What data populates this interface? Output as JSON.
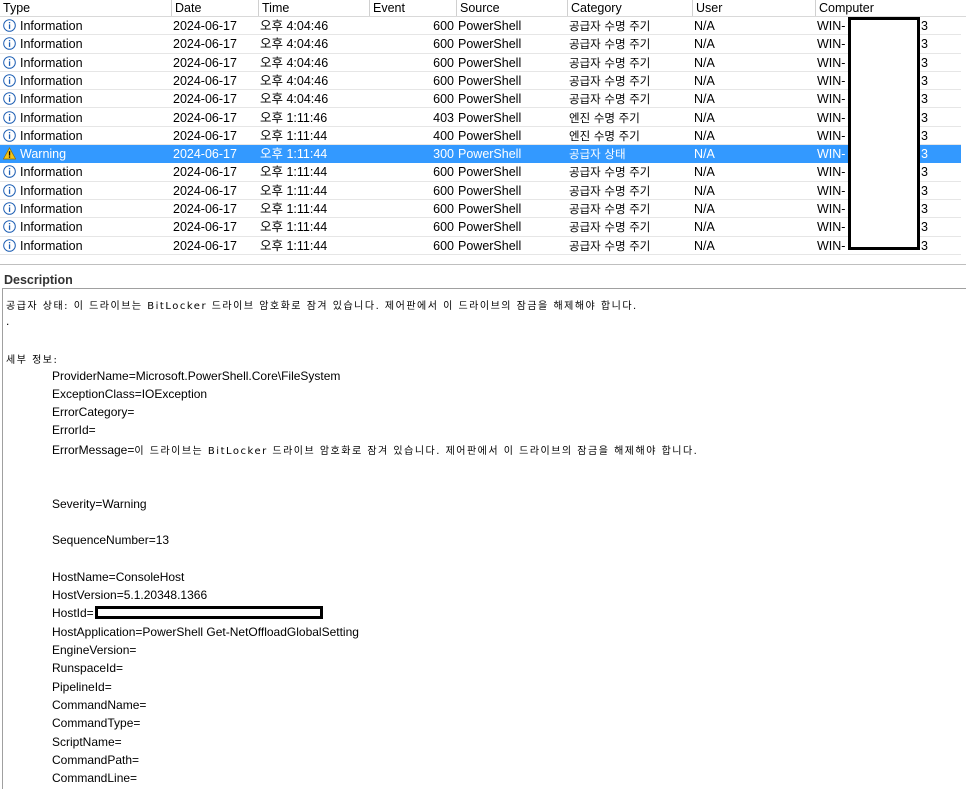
{
  "columns": [
    "Type",
    "Date",
    "Time",
    "Event",
    "Source",
    "Category",
    "User",
    "Computer"
  ],
  "rows": [
    {
      "type": "Information",
      "icon": "info-icon",
      "date": "2024-06-17",
      "time": "오후 4:04:46",
      "event": "600",
      "source": "PowerShell",
      "category": "공급자 수명 주기",
      "user": "N/A",
      "computer": "WIN-",
      "computer_tail": "3",
      "selected": false
    },
    {
      "type": "Information",
      "icon": "info-icon",
      "date": "2024-06-17",
      "time": "오후 4:04:46",
      "event": "600",
      "source": "PowerShell",
      "category": "공급자 수명 주기",
      "user": "N/A",
      "computer": "WIN-",
      "computer_tail": "3",
      "selected": false
    },
    {
      "type": "Information",
      "icon": "info-icon",
      "date": "2024-06-17",
      "time": "오후 4:04:46",
      "event": "600",
      "source": "PowerShell",
      "category": "공급자 수명 주기",
      "user": "N/A",
      "computer": "WIN-",
      "computer_tail": "3",
      "selected": false
    },
    {
      "type": "Information",
      "icon": "info-icon",
      "date": "2024-06-17",
      "time": "오후 4:04:46",
      "event": "600",
      "source": "PowerShell",
      "category": "공급자 수명 주기",
      "user": "N/A",
      "computer": "WIN-",
      "computer_tail": "3",
      "selected": false
    },
    {
      "type": "Information",
      "icon": "info-icon",
      "date": "2024-06-17",
      "time": "오후 4:04:46",
      "event": "600",
      "source": "PowerShell",
      "category": "공급자 수명 주기",
      "user": "N/A",
      "computer": "WIN-",
      "computer_tail": "3",
      "selected": false
    },
    {
      "type": "Information",
      "icon": "info-icon",
      "date": "2024-06-17",
      "time": "오후 1:11:46",
      "event": "403",
      "source": "PowerShell",
      "category": "엔진 수명 주기",
      "user": "N/A",
      "computer": "WIN-",
      "computer_tail": "3",
      "selected": false
    },
    {
      "type": "Information",
      "icon": "info-icon",
      "date": "2024-06-17",
      "time": "오후 1:11:44",
      "event": "400",
      "source": "PowerShell",
      "category": "엔진 수명 주기",
      "user": "N/A",
      "computer": "WIN-",
      "computer_tail": "3",
      "selected": false
    },
    {
      "type": "Warning",
      "icon": "warning-icon",
      "date": "2024-06-17",
      "time": "오후 1:11:44",
      "event": "300",
      "source": "PowerShell",
      "category": "공급자 상태",
      "user": "N/A",
      "computer": "WIN-",
      "computer_tail": "3",
      "selected": true
    },
    {
      "type": "Information",
      "icon": "info-icon",
      "date": "2024-06-17",
      "time": "오후 1:11:44",
      "event": "600",
      "source": "PowerShell",
      "category": "공급자 수명 주기",
      "user": "N/A",
      "computer": "WIN-",
      "computer_tail": "3",
      "selected": false
    },
    {
      "type": "Information",
      "icon": "info-icon",
      "date": "2024-06-17",
      "time": "오후 1:11:44",
      "event": "600",
      "source": "PowerShell",
      "category": "공급자 수명 주기",
      "user": "N/A",
      "computer": "WIN-",
      "computer_tail": "3",
      "selected": false
    },
    {
      "type": "Information",
      "icon": "info-icon",
      "date": "2024-06-17",
      "time": "오후 1:11:44",
      "event": "600",
      "source": "PowerShell",
      "category": "공급자 수명 주기",
      "user": "N/A",
      "computer": "WIN-",
      "computer_tail": "3",
      "selected": false
    },
    {
      "type": "Information",
      "icon": "info-icon",
      "date": "2024-06-17",
      "time": "오후 1:11:44",
      "event": "600",
      "source": "PowerShell",
      "category": "공급자 수명 주기",
      "user": "N/A",
      "computer": "WIN-",
      "computer_tail": "3",
      "selected": false
    },
    {
      "type": "Information",
      "icon": "info-icon",
      "date": "2024-06-17",
      "time": "오후 1:11:44",
      "event": "600",
      "source": "PowerShell",
      "category": "공급자 수명 주기",
      "user": "N/A",
      "computer": "WIN-",
      "computer_tail": "3",
      "selected": false
    }
  ],
  "description": {
    "title": "Description",
    "summary": "공급자 상태: 이 드라이브는 BitLocker 드라이브 암호화로 잠겨 있습니다. 제어판에서 이 드라이브의 잠금을 해제해야 합니다.",
    "dot": ".",
    "details_header": "세부 정보:",
    "provider_name": "ProviderName=Microsoft.PowerShell.Core\\FileSystem",
    "exception_class": "ExceptionClass=IOException",
    "error_category": "ErrorCategory=",
    "error_id": "ErrorId=",
    "error_message_key": "ErrorMessage=",
    "error_message_val": "이 드라이브는 BitLocker 드라이브 암호화로 잠겨 있습니다. 제어판에서 이 드라이브의 잠금을 해제해야 합니다.",
    "severity": "Severity=Warning",
    "sequence_number": "SequenceNumber=13",
    "host_name": "HostName=ConsoleHost",
    "host_version": "HostVersion=5.1.20348.1366",
    "host_id": "HostId=",
    "host_application": "HostApplication=PowerShell Get-NetOffloadGlobalSetting",
    "engine_version": "EngineVersion=",
    "runspace_id": "RunspaceId=",
    "pipeline_id": "PipelineId=",
    "command_name": "CommandName=",
    "command_type": "CommandType=",
    "script_name": "ScriptName=",
    "command_path": "CommandPath=",
    "command_line": "CommandLine="
  },
  "colors": {
    "selection": "#3399ff",
    "info_icon": "#1e5fb4",
    "warning_icon": "#f5c518"
  }
}
